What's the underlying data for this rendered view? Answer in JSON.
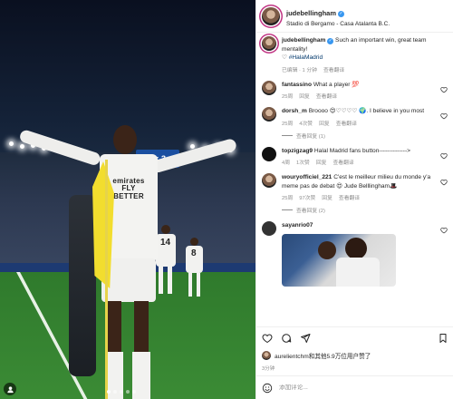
{
  "post": {
    "author": "judebellingham",
    "location": "Stadio di Bergamo - Casa Atalanta B.C.",
    "scoreboard": "1 : 3",
    "jersey_text": "emirates\nFLY BETTER",
    "bg_numbers": [
      "14",
      "8"
    ]
  },
  "caption": {
    "user": "judebellingham",
    "text": "Such an important win, great team mentality!",
    "hashtag": "#HalaMadrid",
    "time": "已编辑 · 1 分钟",
    "see_translation": "查看翻译"
  },
  "comments": [
    {
      "user": "fantassino",
      "text": "What a player 💯",
      "time": "25周",
      "likes": "",
      "reply": "回复",
      "translate": "查看翻译"
    },
    {
      "user": "dorsh_m",
      "text": "Broooo 😍♡♡♡♡ 🌍. I believe in you most",
      "time": "25周",
      "likes": "4次赞",
      "reply": "回复",
      "translate": "查看翻译",
      "view_replies": "查看回复 (1)"
    },
    {
      "user": "topzigzag9",
      "text": "Halal Madrid fans button-------------->",
      "time": "4周",
      "likes": "1次赞",
      "reply": "回复",
      "translate": "查看翻译"
    },
    {
      "user": "wouryofficiel_221",
      "text": "C'est le meilleur milieu du monde y'a meme pas de debat 😍 Jude Belllingham🎩",
      "time": "25周",
      "likes": "97次赞",
      "reply": "回复",
      "translate": "查看翻译",
      "view_replies": "查看回复 (2)"
    },
    {
      "user": "sayanrio07",
      "text": "",
      "time": "",
      "likes": "",
      "reply": "",
      "translate": ""
    }
  ],
  "likes_text": "aurelientchm和其他5.9万位用户赞了",
  "post_time": "3分钟",
  "add_comment_placeholder": "添加评论..."
}
